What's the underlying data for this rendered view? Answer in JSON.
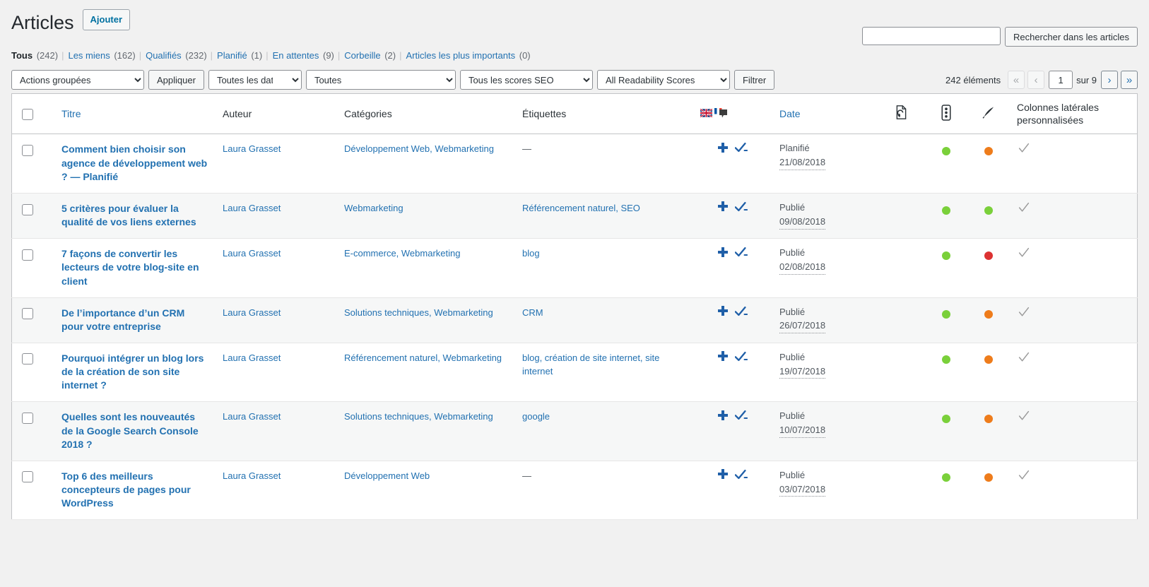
{
  "page": {
    "title": "Articles",
    "add_new_label": "Ajouter"
  },
  "views": [
    {
      "label": "Tous",
      "count": "(242)",
      "current": true
    },
    {
      "label": "Les miens",
      "count": "(162)",
      "current": false
    },
    {
      "label": "Qualifiés",
      "count": "(232)",
      "current": false
    },
    {
      "label": "Planifié",
      "count": "(1)",
      "current": false
    },
    {
      "label": "En attentes",
      "count": "(9)",
      "current": false
    },
    {
      "label": "Corbeille",
      "count": "(2)",
      "current": false
    },
    {
      "label": "Articles les plus importants",
      "count": "(0)",
      "current": false
    }
  ],
  "search": {
    "value": "",
    "placeholder": "",
    "button_label": "Rechercher dans les articles"
  },
  "tablenav": {
    "bulk_actions_selected": "Actions groupées",
    "apply_label": "Appliquer",
    "dates_selected": "Toutes les dates",
    "categories_selected": "Toutes",
    "seo_scores_selected": "Tous les scores SEO",
    "readability_selected": "All Readability Scores",
    "filter_label": "Filtrer",
    "displaying_num": "242 éléments",
    "first_page_label": "«",
    "prev_page_label": "‹",
    "current_page": "1",
    "total_pages_label": "sur 9",
    "next_page_label": "›",
    "last_page_label": "»"
  },
  "columns": {
    "title": "Titre",
    "author": "Auteur",
    "categories": "Catégories",
    "tags": "Étiquettes",
    "languages_icon": "languages-flags-icon",
    "date": "Date",
    "icon_revision": "page-revision-icon",
    "icon_seo": "seo-traffic-light-icon",
    "icon_readability": "readability-pen-icon",
    "sidebar": "Colonnes latérales personnalisées"
  },
  "colors": {
    "link": "#2271b1",
    "green": "#7ad03a",
    "orange": "#ee7c1b",
    "red": "#dc3232",
    "check_gray": "#999999",
    "plus_blue": "#1f5fa8"
  },
  "rows": [
    {
      "title": "Comment bien choisir son agence de développement web ? — Planifié",
      "author": "Laura Grasset",
      "categories": "Développement Web, Webmarketing",
      "tags": "—",
      "tags_empty": true,
      "status": "Planifié",
      "date": "21/08/2018",
      "seo_dot": "#7ad03a",
      "readability_dot": "#ee7c1b",
      "sidebar_check": "✓"
    },
    {
      "title": "5 critères pour évaluer la qualité de vos liens externes",
      "author": "Laura Grasset",
      "categories": "Webmarketing",
      "tags": "Référencement naturel, SEO",
      "tags_empty": false,
      "status": "Publié",
      "date": "09/08/2018",
      "seo_dot": "#7ad03a",
      "readability_dot": "#7ad03a",
      "sidebar_check": "✓"
    },
    {
      "title": "7 façons de convertir les lecteurs de votre blog-site en client",
      "author": "Laura Grasset",
      "categories": "E-commerce, Webmarketing",
      "tags": "blog",
      "tags_empty": false,
      "status": "Publié",
      "date": "02/08/2018",
      "seo_dot": "#7ad03a",
      "readability_dot": "#dc3232",
      "sidebar_check": "✓"
    },
    {
      "title": "De l’importance d’un CRM pour votre entreprise",
      "author": "Laura Grasset",
      "categories": "Solutions techniques, Webmarketing",
      "tags": "CRM",
      "tags_empty": false,
      "status": "Publié",
      "date": "26/07/2018",
      "seo_dot": "#7ad03a",
      "readability_dot": "#ee7c1b",
      "sidebar_check": "✓"
    },
    {
      "title": "Pourquoi intégrer un blog lors de la création de son site internet ?",
      "author": "Laura Grasset",
      "categories": "Référencement naturel, Webmarketing",
      "tags": "blog, création de site internet, site internet",
      "tags_empty": false,
      "status": "Publié",
      "date": "19/07/2018",
      "seo_dot": "#7ad03a",
      "readability_dot": "#ee7c1b",
      "sidebar_check": "✓"
    },
    {
      "title": "Quelles sont les nouveautés de la Google Search Console 2018 ?",
      "author": "Laura Grasset",
      "categories": "Solutions techniques, Webmarketing",
      "tags": "google",
      "tags_empty": false,
      "status": "Publié",
      "date": "10/07/2018",
      "seo_dot": "#7ad03a",
      "readability_dot": "#ee7c1b",
      "sidebar_check": "✓"
    },
    {
      "title": "Top 6 des meilleurs concepteurs de pages pour WordPress",
      "author": "Laura Grasset",
      "categories": "Développement Web",
      "tags": "—",
      "tags_empty": true,
      "status": "Publié",
      "date": "03/07/2018",
      "seo_dot": "#7ad03a",
      "readability_dot": "#ee7c1b",
      "sidebar_check": "✓"
    }
  ]
}
